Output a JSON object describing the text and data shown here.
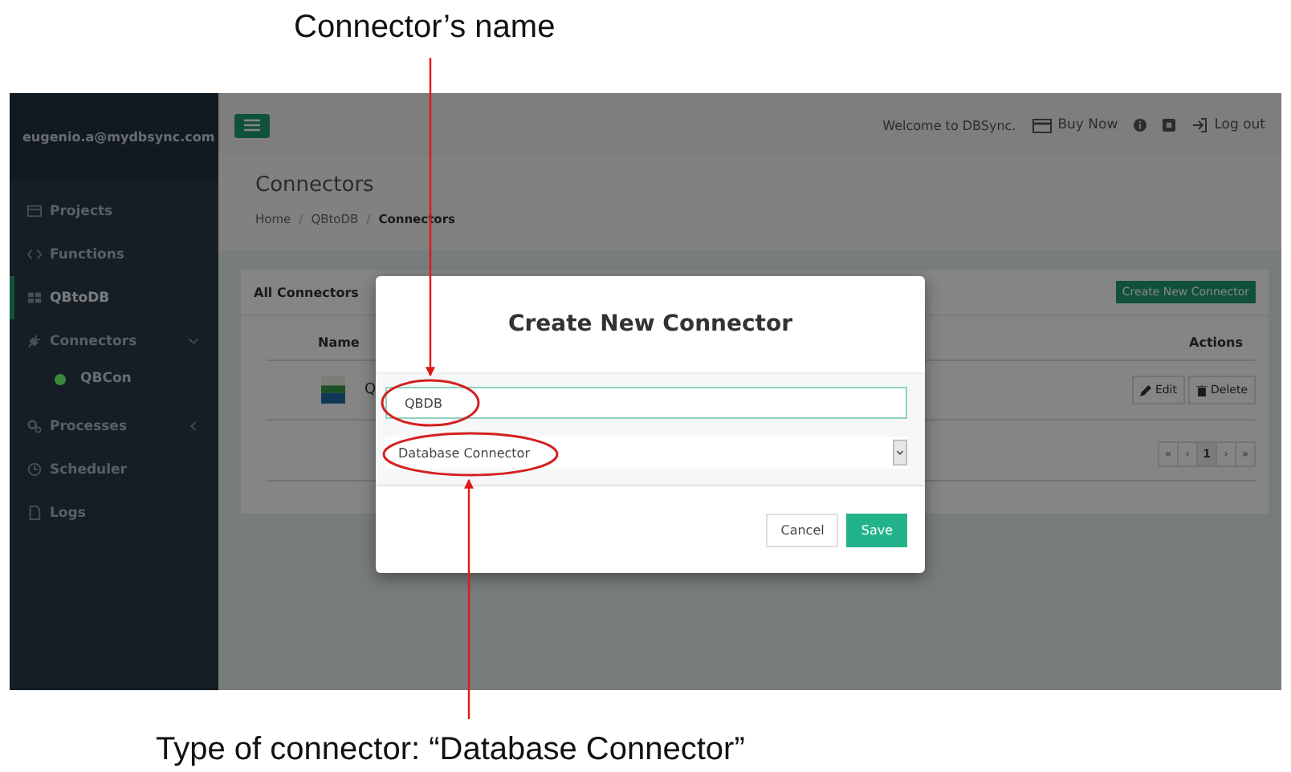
{
  "annotations": [
    {
      "text": "Connector’s name"
    },
    {
      "text": "Type of connector: “Database Connector”"
    }
  ],
  "sidebar": {
    "user": "eugenio.a@mydbsync.com",
    "items": [
      {
        "label": "Projects",
        "selected": false
      },
      {
        "label": "Functions",
        "selected": false
      },
      {
        "label": "QBtoDB",
        "selected": true
      },
      {
        "label": "Connectors",
        "selected": false,
        "expanded": true,
        "children": [
          {
            "label": "QBCon",
            "color": "#3a8a3a"
          }
        ]
      },
      {
        "label": "Processes",
        "selected": false,
        "expanded": false
      },
      {
        "label": "Scheduler",
        "selected": false
      },
      {
        "label": "Logs",
        "selected": false
      }
    ]
  },
  "topbar": {
    "welcome": "Welcome to DBSync.",
    "buy": "Buy Now",
    "logout": "Log out"
  },
  "page": {
    "title": "Connectors",
    "breadcrumb": [
      "Home",
      "QBtoDB",
      "Connectors"
    ],
    "separator": "/"
  },
  "panel": {
    "title": "All Connectors",
    "create_button": "Create New Connector",
    "columns": [
      "Name",
      "Actions"
    ],
    "rows": [
      {
        "name": "Q",
        "actions": [
          "Edit",
          "Delete"
        ]
      }
    ],
    "pagination": [
      {
        "label": "«",
        "selected": false
      },
      {
        "label": "‹",
        "selected": false
      },
      {
        "label": "1",
        "selected": true
      },
      {
        "label": "›",
        "selected": false
      },
      {
        "label": "»",
        "selected": false
      }
    ]
  },
  "modal": {
    "title": "Create New Connector",
    "name_value": "QBDB",
    "type_value": "Database Connector",
    "buttons": [
      "Cancel",
      "Save"
    ]
  }
}
